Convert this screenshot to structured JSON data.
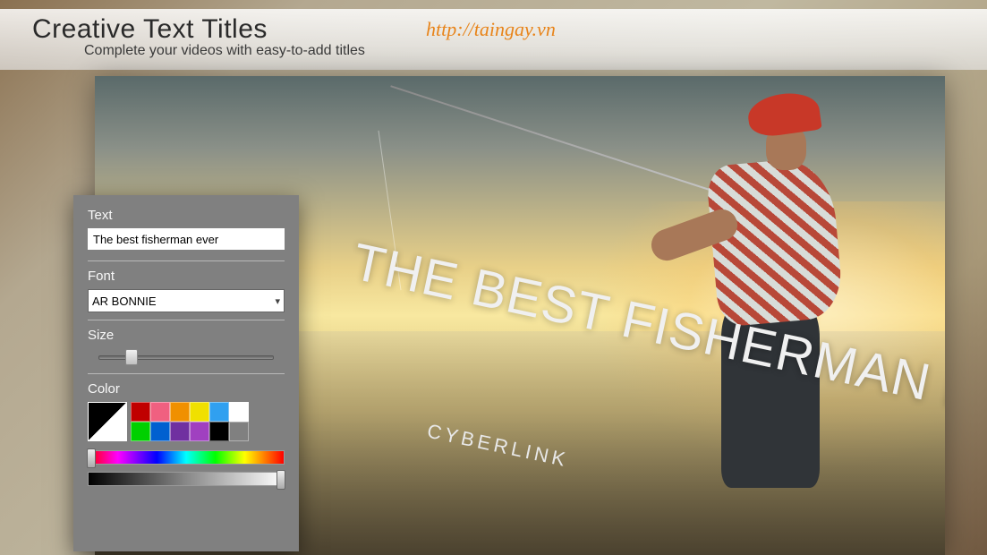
{
  "header": {
    "title": "Creative Text Titles",
    "subtitle": "Complete your videos with easy-to-add titles",
    "link": "http://taingay.vn"
  },
  "canvas": {
    "title_overlay": "THE BEST FISHERMAN EVER",
    "subtitle_overlay": "CYBERLINK"
  },
  "panel": {
    "text_label": "Text",
    "text_value": "The best fisherman ever",
    "font_label": "Font",
    "font_value": "AR BONNIE",
    "size_label": "Size",
    "size_value": 22,
    "color_label": "Color",
    "swatches_row1": [
      "#c00000",
      "#f06080",
      "#f09000",
      "#f0e000",
      "#30a0f0",
      "#ffffff"
    ],
    "swatches_row2": [
      "#00d000",
      "#0060d0",
      "#7030a0",
      "#a040c0",
      "#000000",
      "#808080"
    ]
  }
}
